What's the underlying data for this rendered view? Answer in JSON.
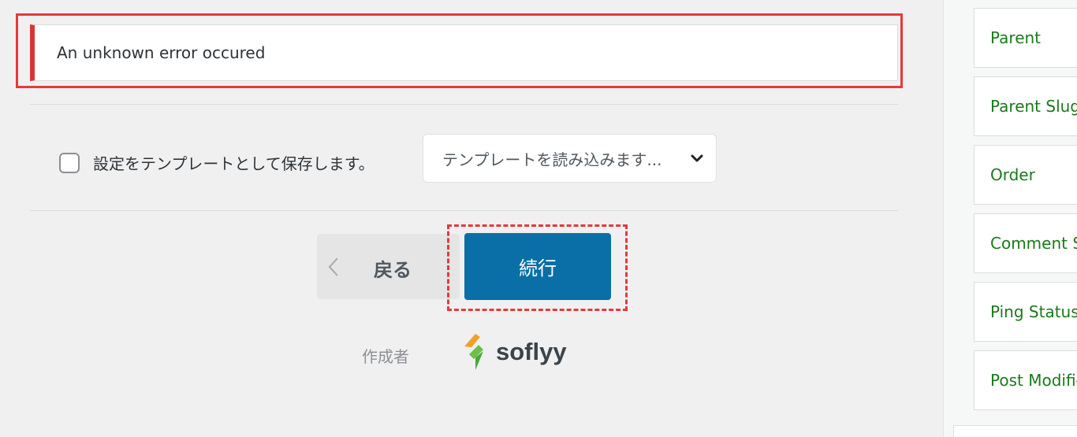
{
  "notice": {
    "message": "An unknown error occured"
  },
  "template": {
    "save_label": "設定をテンプレートとして保存します。",
    "load_placeholder": "テンプレートを読み込みます..."
  },
  "nav": {
    "back_label": "戻る",
    "continue_label": "続行"
  },
  "credit": {
    "label": "作成者",
    "brand": "soflyy"
  },
  "sidebar": {
    "items": [
      {
        "label": "Parent"
      },
      {
        "label": "Parent Slug"
      },
      {
        "label": "Order"
      },
      {
        "label": "Comment Status"
      },
      {
        "label": "Ping Status"
      },
      {
        "label": "Post Modified Date"
      }
    ]
  },
  "colors": {
    "error_accent": "#d63638",
    "highlight": "#e53a3a",
    "primary_button": "#0a6fa6",
    "sidebar_text": "#1a7a1a"
  },
  "icons": {
    "select_chevron": "chevron-down-icon",
    "back_chevron": "chevron-left-icon",
    "brand_logo": "soflyy-logo-icon"
  }
}
